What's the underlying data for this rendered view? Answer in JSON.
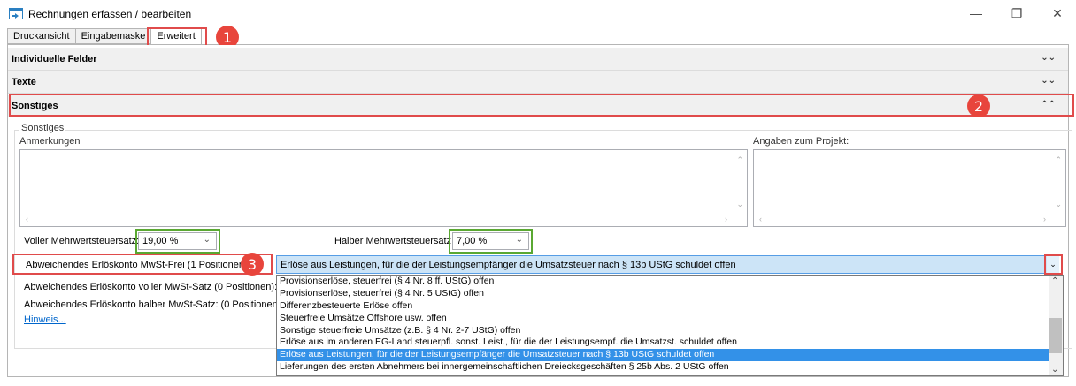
{
  "window": {
    "title": "Rechnungen erfassen / bearbeiten",
    "minimize_glyph": "—",
    "restore_glyph": "❐",
    "close_glyph": "✕"
  },
  "tabs": [
    {
      "label": "Druckansicht",
      "active": false
    },
    {
      "label": "Eingabemaske",
      "active": false
    },
    {
      "label": "Erweitert",
      "active": true
    }
  ],
  "sections": {
    "individual": {
      "label": "Individuelle Felder",
      "chevron": "expand"
    },
    "texte": {
      "label": "Texte",
      "chevron": "expand"
    },
    "sonstiges": {
      "label": "Sonstiges",
      "chevron": "collapse"
    }
  },
  "badges": {
    "one": "1",
    "two": "2",
    "three": "3"
  },
  "group": {
    "title": "Sonstiges",
    "anmerkungen_label": "Anmerkungen",
    "projekt_label": "Angaben zum Projekt:"
  },
  "vat": {
    "full_label": "Voller Mehrwertsteuersatz:",
    "full_value": "19,00 %",
    "half_label": "Halber Mehrwertsteuersatz:",
    "half_value": "7,00 %"
  },
  "accounts": {
    "frei_label": "Abweichendes Erlöskonto MwSt-Frei (1 Positionen):",
    "voll_label": "Abweichendes Erlöskonto voller MwSt-Satz (0 Positionen):",
    "halb_label": "Abweichendes Erlöskonto halber MwSt-Satz: (0 Positionen):",
    "hint_link": "Hinweis...",
    "selected_value": "Erlöse aus Leistungen, für die der Leistungsempfänger die Umsatzsteuer nach § 13b UStG schuldet offen",
    "options": [
      "Provisionserlöse, steuerfrei (§ 4 Nr. 8 ff. UStG) offen",
      "Provisionserlöse, steuerfrei (§ 4 Nr. 5 UStG) offen",
      "Differenzbesteuerte Erlöse offen",
      "Steuerfreie Umsätze Offshore usw. offen",
      "Sonstige steuerfreie Umsätze (z.B. § 4 Nr. 2-7 UStG) offen",
      "Erlöse aus im anderen EG-Land steuerpfl. sonst. Leist., für die der Leistungsempf. die Umsatzst. schuldet offen",
      "Erlöse aus Leistungen, für die der Leistungsempfänger die Umsatzsteuer nach § 13b UStG schuldet offen",
      "Lieferungen des ersten Abnehmers bei innergemeinschaftlichen Dreiecksgeschäften § 25b Abs. 2 UStG offen"
    ],
    "selected_index": 6
  },
  "colors": {
    "highlight_red": "#e04b4b",
    "highlight_green": "#5aa832",
    "badge_red": "#e8453c",
    "selection_blue": "#3391e8"
  }
}
